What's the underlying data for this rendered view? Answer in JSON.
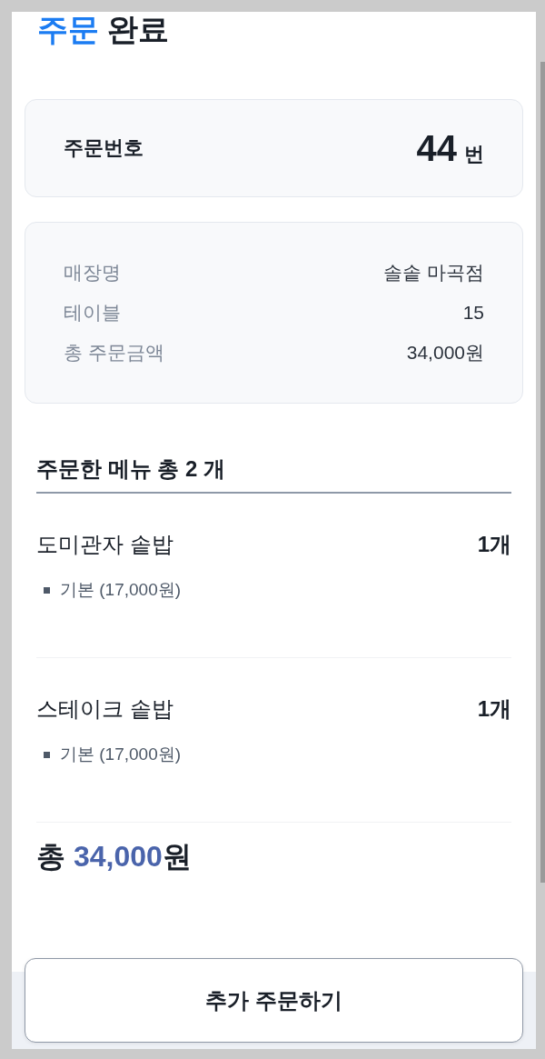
{
  "header": {
    "title_highlight": "주문",
    "title_rest": "완료"
  },
  "order_number": {
    "label": "주문번호",
    "number": "44",
    "unit": "번"
  },
  "order_info": [
    {
      "label": "매장명",
      "value": "솔솥 마곡점"
    },
    {
      "label": "테이블",
      "value": "15"
    },
    {
      "label": "총 주문금액",
      "value": "34,000원"
    }
  ],
  "menu": {
    "heading": "주문한 메뉴 총 2 개",
    "items": [
      {
        "name": "도미관자 솥밥",
        "quantity": "1개",
        "options": [
          "기본 (17,000원)"
        ]
      },
      {
        "name": "스테이크 솥밥",
        "quantity": "1개",
        "options": [
          "기본 (17,000원)"
        ]
      }
    ]
  },
  "total": {
    "prefix": "총",
    "amount": "34,000",
    "unit": "원"
  },
  "footer": {
    "button": "추가 주문하기"
  }
}
